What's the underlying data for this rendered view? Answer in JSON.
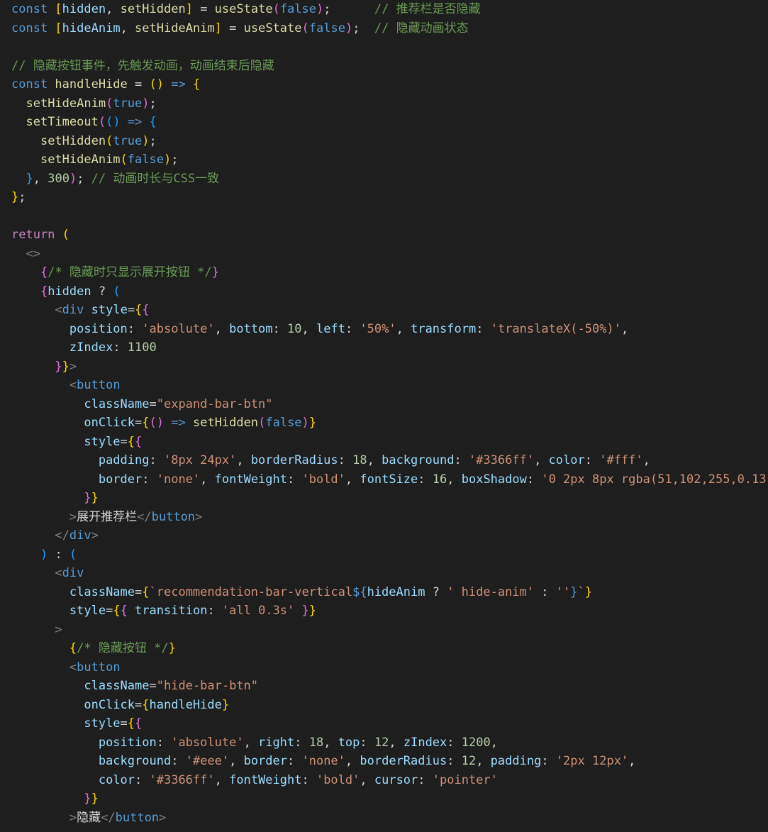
{
  "editor": {
    "language": "jsx",
    "theme": "dark",
    "colors": {
      "background": "#1e1e1e",
      "keyword": "#569cd6",
      "variable": "#9cdcfe",
      "function": "#dcdcaa",
      "comment": "#6a9955",
      "number": "#b5cea8",
      "string": "#ce9178",
      "control": "#c586c0",
      "tag_bracket": "#808080",
      "bracket_1": "#ffd700",
      "bracket_2": "#da70d6",
      "bracket_3": "#179fff"
    },
    "lines": [
      [
        [
          "kw",
          "const "
        ],
        [
          "b1",
          "["
        ],
        [
          "var",
          "hidden"
        ],
        [
          "op",
          ", "
        ],
        [
          "fn",
          "setHidden"
        ],
        [
          "b1",
          "]"
        ],
        [
          "op",
          " = "
        ],
        [
          "fn",
          "useState"
        ],
        [
          "b2",
          "("
        ],
        [
          "kw",
          "false"
        ],
        [
          "b2",
          ")"
        ],
        [
          "op",
          ";      "
        ],
        [
          "cmt",
          "// 推荐栏是否隐藏"
        ]
      ],
      [
        [
          "kw",
          "const "
        ],
        [
          "b1",
          "["
        ],
        [
          "var",
          "hideAnim"
        ],
        [
          "op",
          ", "
        ],
        [
          "fn",
          "setHideAnim"
        ],
        [
          "b1",
          "]"
        ],
        [
          "op",
          " = "
        ],
        [
          "fn",
          "useState"
        ],
        [
          "b2",
          "("
        ],
        [
          "kw",
          "false"
        ],
        [
          "b2",
          ")"
        ],
        [
          "op",
          ";  "
        ],
        [
          "cmt",
          "// 隐藏动画状态"
        ]
      ],
      [],
      [
        [
          "cmt",
          "// 隐藏按钮事件，先触发动画，动画结束后隐藏"
        ]
      ],
      [
        [
          "kw",
          "const "
        ],
        [
          "fn",
          "handleHide"
        ],
        [
          "op",
          " = "
        ],
        [
          "b1",
          "()"
        ],
        [
          "op",
          " "
        ],
        [
          "kw",
          "=>"
        ],
        [
          "op",
          " "
        ],
        [
          "b1",
          "{"
        ]
      ],
      [
        [
          "op",
          "  "
        ],
        [
          "fn",
          "setHideAnim"
        ],
        [
          "b2",
          "("
        ],
        [
          "kw",
          "true"
        ],
        [
          "b2",
          ")"
        ],
        [
          "op",
          ";"
        ]
      ],
      [
        [
          "op",
          "  "
        ],
        [
          "fn",
          "setTimeout"
        ],
        [
          "b2",
          "("
        ],
        [
          "b3",
          "()"
        ],
        [
          "op",
          " "
        ],
        [
          "kw",
          "=>"
        ],
        [
          "op",
          " "
        ],
        [
          "b3",
          "{"
        ]
      ],
      [
        [
          "op",
          "    "
        ],
        [
          "fn",
          "setHidden"
        ],
        [
          "b1",
          "("
        ],
        [
          "kw",
          "true"
        ],
        [
          "b1",
          ")"
        ],
        [
          "op",
          ";"
        ]
      ],
      [
        [
          "op",
          "    "
        ],
        [
          "fn",
          "setHideAnim"
        ],
        [
          "b1",
          "("
        ],
        [
          "kw",
          "false"
        ],
        [
          "b1",
          ")"
        ],
        [
          "op",
          ";"
        ]
      ],
      [
        [
          "op",
          "  "
        ],
        [
          "b3",
          "}"
        ],
        [
          "op",
          ", "
        ],
        [
          "num",
          "300"
        ],
        [
          "b2",
          ")"
        ],
        [
          "op",
          "; "
        ],
        [
          "cmt",
          "// 动画时长与CSS一致"
        ]
      ],
      [
        [
          "b1",
          "}"
        ],
        [
          "op",
          ";"
        ]
      ],
      [],
      [
        [
          "ctl",
          "return "
        ],
        [
          "b1",
          "("
        ]
      ],
      [
        [
          "op",
          "  "
        ],
        [
          "tag",
          "<>"
        ]
      ],
      [
        [
          "op",
          "    "
        ],
        [
          "b2",
          "{"
        ],
        [
          "cmt",
          "/* 隐藏时只显示展开按钮 */"
        ],
        [
          "b2",
          "}"
        ]
      ],
      [
        [
          "op",
          "    "
        ],
        [
          "b2",
          "{"
        ],
        [
          "var",
          "hidden"
        ],
        [
          "op",
          " ? "
        ],
        [
          "b3",
          "("
        ]
      ],
      [
        [
          "op",
          "      "
        ],
        [
          "tag",
          "<"
        ],
        [
          "tagn",
          "div"
        ],
        [
          "op",
          " "
        ],
        [
          "attr",
          "style"
        ],
        [
          "op",
          "="
        ],
        [
          "b1",
          "{"
        ],
        [
          "b2",
          "{"
        ]
      ],
      [
        [
          "op",
          "        "
        ],
        [
          "var",
          "position"
        ],
        [
          "op",
          ": "
        ],
        [
          "str",
          "'absolute'"
        ],
        [
          "op",
          ", "
        ],
        [
          "var",
          "bottom"
        ],
        [
          "op",
          ": "
        ],
        [
          "num",
          "10"
        ],
        [
          "op",
          ", "
        ],
        [
          "var",
          "left"
        ],
        [
          "op",
          ": "
        ],
        [
          "str",
          "'50%'"
        ],
        [
          "op",
          ", "
        ],
        [
          "var",
          "transform"
        ],
        [
          "op",
          ": "
        ],
        [
          "str",
          "'translateX(-50%)'"
        ],
        [
          "op",
          ","
        ]
      ],
      [
        [
          "op",
          "        "
        ],
        [
          "var",
          "zIndex"
        ],
        [
          "op",
          ": "
        ],
        [
          "num",
          "1100"
        ]
      ],
      [
        [
          "op",
          "      "
        ],
        [
          "b2",
          "}"
        ],
        [
          "b1",
          "}"
        ],
        [
          "tag",
          ">"
        ]
      ],
      [
        [
          "op",
          "        "
        ],
        [
          "tag",
          "<"
        ],
        [
          "tagn",
          "button"
        ]
      ],
      [
        [
          "op",
          "          "
        ],
        [
          "attr",
          "className"
        ],
        [
          "op",
          "="
        ],
        [
          "str",
          "\"expand-bar-btn\""
        ]
      ],
      [
        [
          "op",
          "          "
        ],
        [
          "attr",
          "onClick"
        ],
        [
          "op",
          "="
        ],
        [
          "b1",
          "{"
        ],
        [
          "b2",
          "()"
        ],
        [
          "op",
          " "
        ],
        [
          "kw",
          "=>"
        ],
        [
          "op",
          " "
        ],
        [
          "fn",
          "setHidden"
        ],
        [
          "b2",
          "("
        ],
        [
          "kw",
          "false"
        ],
        [
          "b2",
          ")"
        ],
        [
          "b1",
          "}"
        ]
      ],
      [
        [
          "op",
          "          "
        ],
        [
          "attr",
          "style"
        ],
        [
          "op",
          "="
        ],
        [
          "b1",
          "{"
        ],
        [
          "b2",
          "{"
        ]
      ],
      [
        [
          "op",
          "            "
        ],
        [
          "var",
          "padding"
        ],
        [
          "op",
          ": "
        ],
        [
          "str",
          "'8px 24px'"
        ],
        [
          "op",
          ", "
        ],
        [
          "var",
          "borderRadius"
        ],
        [
          "op",
          ": "
        ],
        [
          "num",
          "18"
        ],
        [
          "op",
          ", "
        ],
        [
          "var",
          "background"
        ],
        [
          "op",
          ": "
        ],
        [
          "str",
          "'#3366ff'"
        ],
        [
          "op",
          ", "
        ],
        [
          "var",
          "color"
        ],
        [
          "op",
          ": "
        ],
        [
          "str",
          "'#fff'"
        ],
        [
          "op",
          ","
        ]
      ],
      [
        [
          "op",
          "            "
        ],
        [
          "var",
          "border"
        ],
        [
          "op",
          ": "
        ],
        [
          "str",
          "'none'"
        ],
        [
          "op",
          ", "
        ],
        [
          "var",
          "fontWeight"
        ],
        [
          "op",
          ": "
        ],
        [
          "str",
          "'bold'"
        ],
        [
          "op",
          ", "
        ],
        [
          "var",
          "fontSize"
        ],
        [
          "op",
          ": "
        ],
        [
          "num",
          "16"
        ],
        [
          "op",
          ", "
        ],
        [
          "var",
          "boxShadow"
        ],
        [
          "op",
          ": "
        ],
        [
          "str",
          "'0 2px 8px rgba(51,102,255,0.13"
        ]
      ],
      [
        [
          "op",
          "          "
        ],
        [
          "b2",
          "}"
        ],
        [
          "b1",
          "}"
        ]
      ],
      [
        [
          "op",
          "        "
        ],
        [
          "tag",
          ">"
        ],
        [
          "text",
          "展开推荐栏"
        ],
        [
          "tag",
          "</"
        ],
        [
          "tagn",
          "button"
        ],
        [
          "tag",
          ">"
        ]
      ],
      [
        [
          "op",
          "      "
        ],
        [
          "tag",
          "</"
        ],
        [
          "tagn",
          "div"
        ],
        [
          "tag",
          ">"
        ]
      ],
      [
        [
          "op",
          "    "
        ],
        [
          "b3",
          ")"
        ],
        [
          "op",
          " : "
        ],
        [
          "b3",
          "("
        ]
      ],
      [
        [
          "op",
          "      "
        ],
        [
          "tag",
          "<"
        ],
        [
          "tagn",
          "div"
        ]
      ],
      [
        [
          "op",
          "        "
        ],
        [
          "attr",
          "className"
        ],
        [
          "op",
          "="
        ],
        [
          "b1",
          "{"
        ],
        [
          "str",
          "`recommendation-bar-vertical"
        ],
        [
          "kw",
          "${"
        ],
        [
          "var",
          "hideAnim"
        ],
        [
          "op",
          " ? "
        ],
        [
          "str",
          "' hide-anim'"
        ],
        [
          "op",
          " : "
        ],
        [
          "str",
          "''"
        ],
        [
          "kw",
          "}"
        ],
        [
          "str",
          "`"
        ],
        [
          "b1",
          "}"
        ]
      ],
      [
        [
          "op",
          "        "
        ],
        [
          "attr",
          "style"
        ],
        [
          "op",
          "="
        ],
        [
          "b1",
          "{"
        ],
        [
          "b2",
          "{"
        ],
        [
          "op",
          " "
        ],
        [
          "var",
          "transition"
        ],
        [
          "op",
          ": "
        ],
        [
          "str",
          "'all 0.3s'"
        ],
        [
          "op",
          " "
        ],
        [
          "b2",
          "}"
        ],
        [
          "b1",
          "}"
        ]
      ],
      [
        [
          "op",
          "      "
        ],
        [
          "tag",
          ">"
        ]
      ],
      [
        [
          "op",
          "        "
        ],
        [
          "b1",
          "{"
        ],
        [
          "cmt",
          "/* 隐藏按钮 */"
        ],
        [
          "b1",
          "}"
        ]
      ],
      [
        [
          "op",
          "        "
        ],
        [
          "tag",
          "<"
        ],
        [
          "tagn",
          "button"
        ]
      ],
      [
        [
          "op",
          "          "
        ],
        [
          "attr",
          "className"
        ],
        [
          "op",
          "="
        ],
        [
          "str",
          "\"hide-bar-btn\""
        ]
      ],
      [
        [
          "op",
          "          "
        ],
        [
          "attr",
          "onClick"
        ],
        [
          "op",
          "="
        ],
        [
          "b1",
          "{"
        ],
        [
          "var",
          "handleHide"
        ],
        [
          "b1",
          "}"
        ]
      ],
      [
        [
          "op",
          "          "
        ],
        [
          "attr",
          "style"
        ],
        [
          "op",
          "="
        ],
        [
          "b1",
          "{"
        ],
        [
          "b2",
          "{"
        ]
      ],
      [
        [
          "op",
          "            "
        ],
        [
          "var",
          "position"
        ],
        [
          "op",
          ": "
        ],
        [
          "str",
          "'absolute'"
        ],
        [
          "op",
          ", "
        ],
        [
          "var",
          "right"
        ],
        [
          "op",
          ": "
        ],
        [
          "num",
          "18"
        ],
        [
          "op",
          ", "
        ],
        [
          "var",
          "top"
        ],
        [
          "op",
          ": "
        ],
        [
          "num",
          "12"
        ],
        [
          "op",
          ", "
        ],
        [
          "var",
          "zIndex"
        ],
        [
          "op",
          ": "
        ],
        [
          "num",
          "1200"
        ],
        [
          "op",
          ","
        ]
      ],
      [
        [
          "op",
          "            "
        ],
        [
          "var",
          "background"
        ],
        [
          "op",
          ": "
        ],
        [
          "str",
          "'#eee'"
        ],
        [
          "op",
          ", "
        ],
        [
          "var",
          "border"
        ],
        [
          "op",
          ": "
        ],
        [
          "str",
          "'none'"
        ],
        [
          "op",
          ", "
        ],
        [
          "var",
          "borderRadius"
        ],
        [
          "op",
          ": "
        ],
        [
          "num",
          "12"
        ],
        [
          "op",
          ", "
        ],
        [
          "var",
          "padding"
        ],
        [
          "op",
          ": "
        ],
        [
          "str",
          "'2px 12px'"
        ],
        [
          "op",
          ","
        ]
      ],
      [
        [
          "op",
          "            "
        ],
        [
          "var",
          "color"
        ],
        [
          "op",
          ": "
        ],
        [
          "str",
          "'#3366ff'"
        ],
        [
          "op",
          ", "
        ],
        [
          "var",
          "fontWeight"
        ],
        [
          "op",
          ": "
        ],
        [
          "str",
          "'bold'"
        ],
        [
          "op",
          ", "
        ],
        [
          "var",
          "cursor"
        ],
        [
          "op",
          ": "
        ],
        [
          "str",
          "'pointer'"
        ]
      ],
      [
        [
          "op",
          "          "
        ],
        [
          "b2",
          "}"
        ],
        [
          "b1",
          "}"
        ]
      ],
      [
        [
          "op",
          "        "
        ],
        [
          "tag",
          ">"
        ],
        [
          "text",
          "隐藏"
        ],
        [
          "tag",
          "</"
        ],
        [
          "tagn",
          "button"
        ],
        [
          "tag",
          ">"
        ]
      ]
    ]
  }
}
